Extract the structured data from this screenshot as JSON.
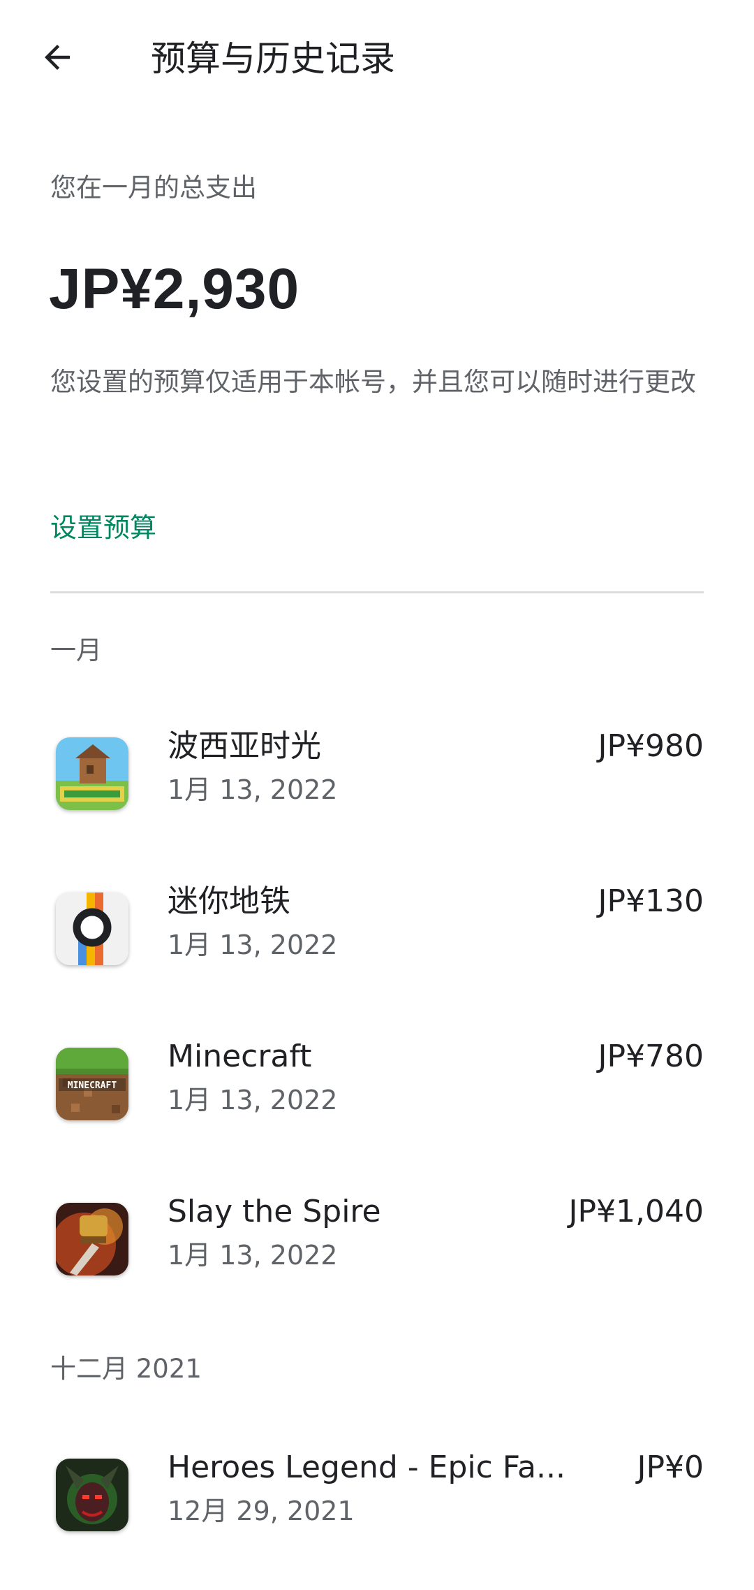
{
  "header": {
    "title": "预算与历史记录",
    "back_icon": "arrow-back-icon"
  },
  "summary": {
    "label": "您在一月的总支出",
    "amount": "JP¥2,930",
    "note": "您设置的预算仅适用于本帐号，并且您可以随时进行更改",
    "set_budget_label": "设置预算",
    "accent_color": "#01875f"
  },
  "months": [
    {
      "label": "一月",
      "purchases": [
        {
          "name": "波西亚时光",
          "date": "1月 13, 2022",
          "price": "JP¥980",
          "icon": "my-time-at-portia-icon"
        },
        {
          "name": "迷你地铁",
          "date": "1月 13, 2022",
          "price": "JP¥130",
          "icon": "mini-metro-icon"
        },
        {
          "name": "Minecraft",
          "date": "1月 13, 2022",
          "price": "JP¥780",
          "icon": "minecraft-icon"
        },
        {
          "name": "Slay the Spire",
          "date": "1月 13, 2022",
          "price": "JP¥1,040",
          "icon": "slay-the-spire-icon"
        }
      ]
    },
    {
      "label": "十二月 2021",
      "purchases": [
        {
          "name": "Heroes Legend - Epic Fa...",
          "date": "12月 29, 2021",
          "price": "JP¥0",
          "icon": "heroes-legend-icon"
        }
      ]
    }
  ]
}
